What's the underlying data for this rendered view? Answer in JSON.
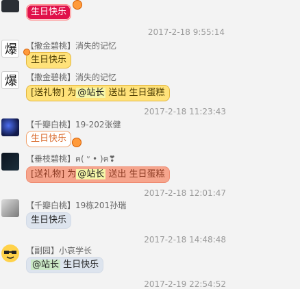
{
  "messages": [
    {
      "name": "",
      "text": "生日快乐"
    },
    {
      "time": "2017-2-18 9:55:14",
      "badge": "【撒金碧桃】",
      "name": "消失的记忆",
      "text": "生日快乐"
    },
    {
      "badge": "【撒金碧桃】",
      "name": "消失的记忆",
      "text_parts": [
        "[送礼物] 为",
        "@站长",
        " 送出 生日蛋糕"
      ]
    },
    {
      "time": "2017-2-18 11:23:43",
      "badge": "【千瓣白桃】",
      "name": "19-202张健",
      "text": "生日快乐"
    },
    {
      "badge": "【垂枝碧桃】",
      "name": "ฅ(   ᐡ •   )ฅ❣",
      "text_parts": [
        "[送礼物] 为",
        "@站长",
        " 送出 生日蛋糕"
      ]
    },
    {
      "time": "2017-2-18 12:01:47",
      "badge": "【千瓣白桃】",
      "name": "19栋201孙瑞",
      "text": "生日快乐"
    },
    {
      "time": "2017-2-18 14:48:48",
      "badge": "【副园】",
      "name": "小哀学长",
      "text_parts": [
        "@站长",
        " 生日快乐"
      ]
    },
    {
      "time": "2017-2-19 22:54:52"
    }
  ],
  "colors": {
    "background": "#f3f3f3",
    "timestamp": "#9a9a9a"
  }
}
